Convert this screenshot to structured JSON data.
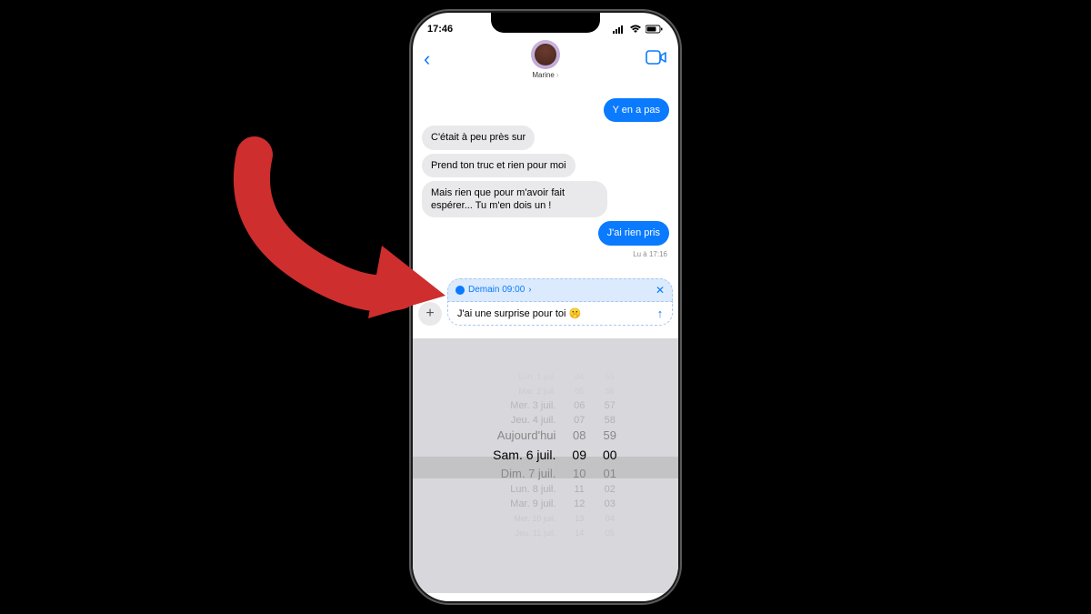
{
  "status": {
    "time": "17:46"
  },
  "contact": {
    "name": "Marine"
  },
  "messages": {
    "sent1": "Y en a pas",
    "recv1": "C'était à peu près sur",
    "recv2": "Prend ton truc et rien pour moi",
    "recv3": "Mais rien que pour m'avoir fait espérer... Tu m'en dois un !",
    "sent2": "J'ai rien pris",
    "read_receipt": "Lu à 17:16"
  },
  "schedule": {
    "label": "Demain 09:00",
    "chevron": "›"
  },
  "compose": {
    "text": "J'ai une surprise pour toi 🤫"
  },
  "picker": {
    "dates": [
      "Lun. 1 juil.",
      "Mar. 2 juil.",
      "Mer. 3 juil.",
      "Jeu. 4 juil.",
      "Aujourd'hui",
      "Sam. 6 juil.",
      "Dim. 7 juil.",
      "Lun. 8 juil.",
      "Mar. 9 juil.",
      "Mer. 10 juil.",
      "Jeu. 11 juil."
    ],
    "hours": [
      "04",
      "05",
      "06",
      "07",
      "08",
      "09",
      "10",
      "11",
      "12",
      "13",
      "14"
    ],
    "minutes": [
      "55",
      "56",
      "57",
      "58",
      "59",
      "00",
      "01",
      "02",
      "03",
      "04",
      "05"
    ]
  }
}
